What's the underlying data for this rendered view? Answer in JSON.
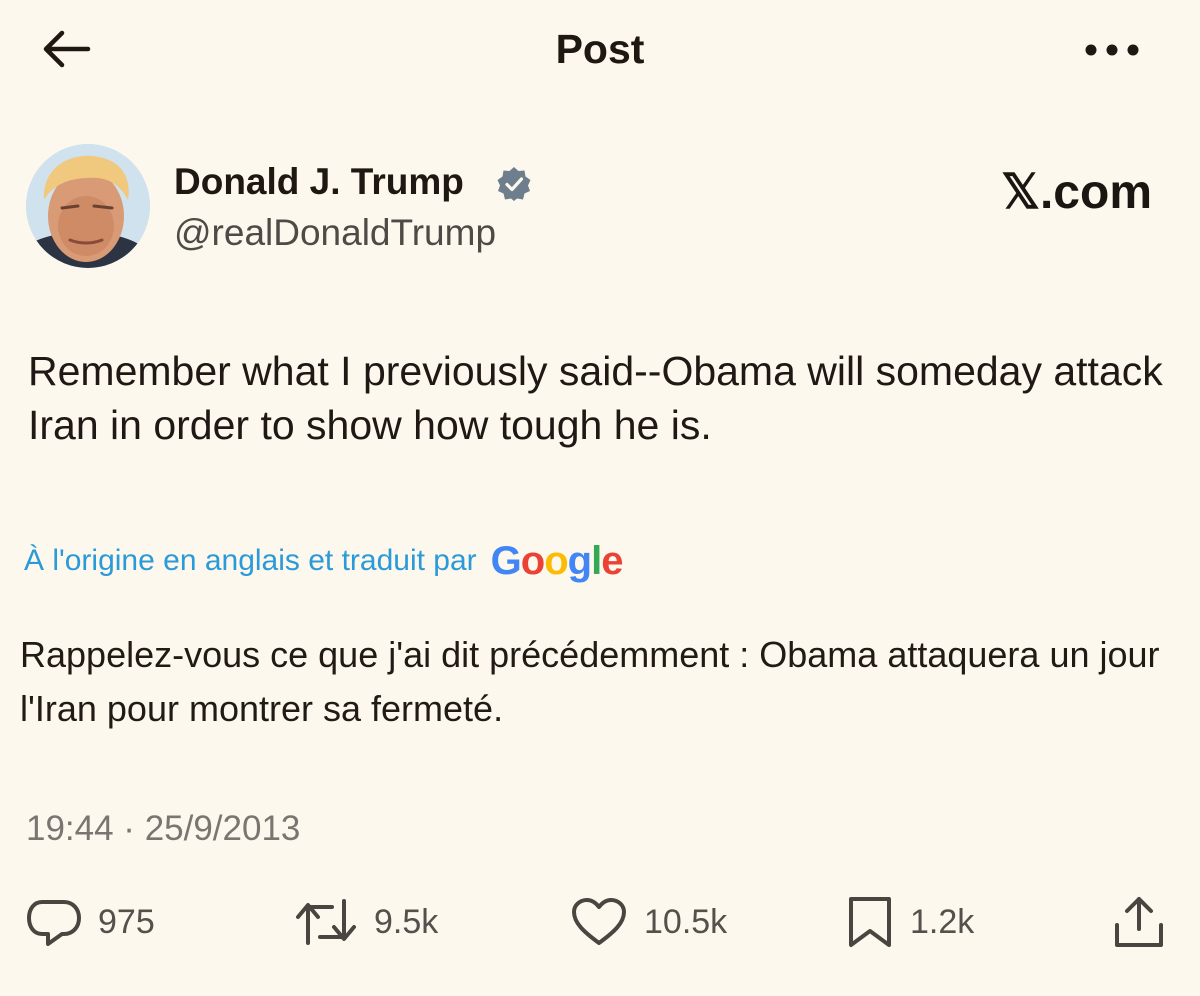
{
  "header": {
    "title": "Post",
    "back_icon": "arrow-left-icon",
    "more_icon": "more-horizontal-icon"
  },
  "author": {
    "display_name": "Donald J. Trump",
    "handle": "@realDonaldTrump",
    "verified_icon": "verified-badge-icon",
    "verified_color": "#6f7e8c"
  },
  "watermark": {
    "text": "𝕏.com"
  },
  "post": {
    "text": "Remember what I previously said--Obama will someday attack Iran in order to show how tough he is."
  },
  "translation": {
    "label": "À l'origine en anglais et traduit par",
    "provider": "Google",
    "text": "Rappelez-vous ce que j'ai dit précédemment : Obama attaquera un jour l'Iran pour montrer sa fermeté."
  },
  "timestamp": "19:44 · 25/9/2013",
  "actions": {
    "replies": {
      "icon": "reply-icon",
      "count": "975"
    },
    "reposts": {
      "icon": "repost-icon",
      "count": "9.5k"
    },
    "likes": {
      "icon": "heart-icon",
      "count": "10.5k"
    },
    "bookmarks": {
      "icon": "bookmark-icon",
      "count": "1.2k"
    },
    "share": {
      "icon": "share-icon"
    }
  },
  "colors": {
    "background": "#fdf8ee",
    "text": "#1f1712",
    "secondary_text": "#7a7570",
    "link": "#2a9ad8",
    "google_blue": "#4285F4",
    "google_red": "#EA4335",
    "google_yellow": "#FBBC05",
    "google_green": "#34A853"
  }
}
